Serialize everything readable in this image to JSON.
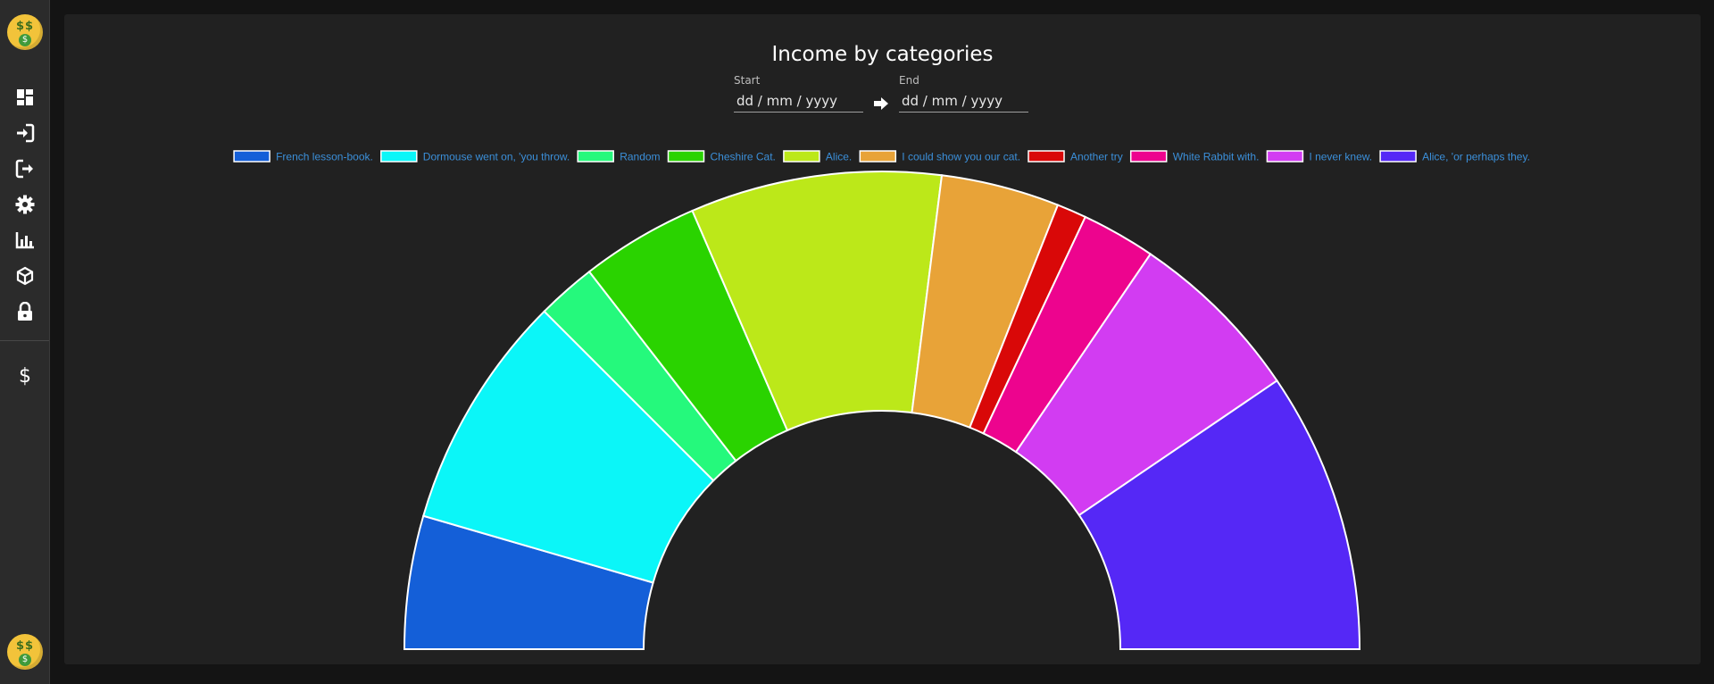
{
  "sidebar": {
    "items": [
      {
        "name": "dashboard",
        "icon": "dashboard-icon"
      },
      {
        "name": "login",
        "icon": "sign-in-icon"
      },
      {
        "name": "logout",
        "icon": "sign-out-icon"
      },
      {
        "name": "settings",
        "icon": "gear-icon"
      },
      {
        "name": "stats",
        "icon": "bar-chart-icon"
      },
      {
        "name": "products",
        "icon": "cube-icon"
      },
      {
        "name": "security",
        "icon": "lock-icon"
      }
    ],
    "currency_symbol": "$",
    "avatar_symbol": "$$",
    "avatar_mouth": "$"
  },
  "page": {
    "title": "Income by categories",
    "start_label": "Start",
    "start_value": "dd / mm / yyyy",
    "end_label": "End",
    "end_value": "dd / mm / yyyy"
  },
  "chart_data": {
    "type": "pie",
    "variant": "half-doughnut",
    "title": "",
    "legend_position": "top",
    "categories": [
      "French lesson-book.",
      "Dormouse went on, 'you throw.",
      "Random",
      "Cheshire Cat.",
      "Alice.",
      "I could show you our cat.",
      "Another try",
      "White Rabbit with.",
      "I never knew.",
      "Alice, 'or perhaps they."
    ],
    "values": [
      9,
      16,
      4,
      8,
      17,
      8,
      2,
      5,
      12,
      19
    ],
    "colors": [
      "#145fd8",
      "#0bf6f8",
      "#25f97c",
      "#2ad300",
      "#bce819",
      "#e8a338",
      "#d90808",
      "#ed048e",
      "#d23cf2",
      "#5528f6"
    ]
  }
}
